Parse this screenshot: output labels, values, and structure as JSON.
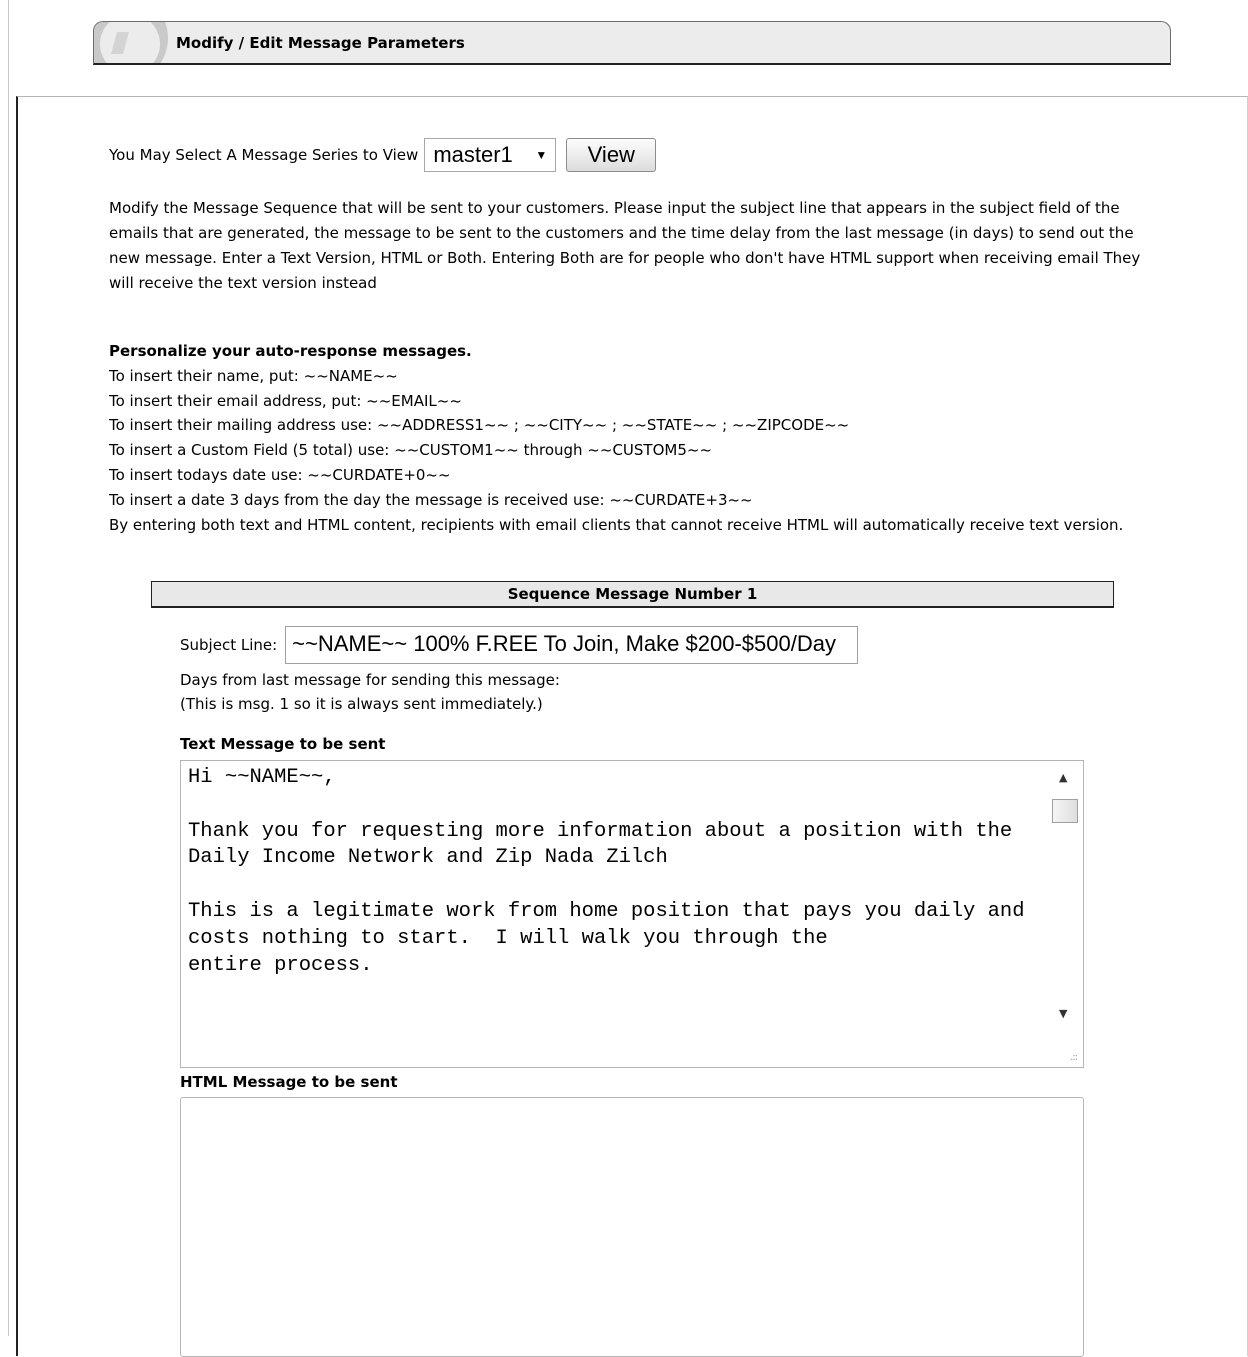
{
  "header": {
    "title": "Modify / Edit Message Parameters"
  },
  "selector": {
    "label": "You May Select A Message Series to View",
    "selected": "master1",
    "button": "View"
  },
  "intro": "Modify the Message Sequence that will be sent to your customers. Please input the subject line that appears in the subject field of the emails that are generated, the message to be sent to the customers and the time delay from the last message (in days) to send out the new message. Enter a Text Version, HTML or Both. Entering Both are for people who don't have HTML support when receiving email They will receive the text version instead",
  "personalize": {
    "heading": "Personalize your auto-response messages.",
    "lines": [
      "To insert their name, put: ~~NAME~~",
      "To insert their email address, put: ~~EMAIL~~",
      "To insert their mailing address use: ~~ADDRESS1~~ ; ~~CITY~~ ; ~~STATE~~ ; ~~ZIPCODE~~",
      "To insert a Custom Field (5 total) use: ~~CUSTOM1~~ through ~~CUSTOM5~~",
      "To insert todays date use: ~~CURDATE+0~~",
      "To insert a date 3 days from the day the message is received use: ~~CURDATE+3~~",
      "By entering both text and HTML content, recipients with email clients that cannot receive HTML will automatically receive text version."
    ]
  },
  "sequence": {
    "title": "Sequence Message Number 1",
    "subject_label": "Subject Line:",
    "subject_value": "~~NAME~~  100% F.REE To Join, Make $200-$500/Day",
    "days_label": "Days from last message for sending this message:",
    "days_note": "(This is msg. 1 so it is always sent immediately.)",
    "text_label": "Text Message to be sent",
    "text_value": "Hi ~~NAME~~,\n\nThank you for requesting more information about a position with the\nDaily Income Network and Zip Nada Zilch\n\nThis is a legitimate work from home position that pays you daily and costs nothing to start.  I will walk you through the\nentire process.",
    "html_label": "HTML Message to be sent",
    "html_value": ""
  },
  "icons": {
    "header": "swoosh-logo-icon",
    "select": "chevron-down-icon",
    "scroll_up": "scroll-up-arrow-icon",
    "scroll_down": "scroll-down-arrow-icon",
    "resize": "resize-grip-icon"
  }
}
